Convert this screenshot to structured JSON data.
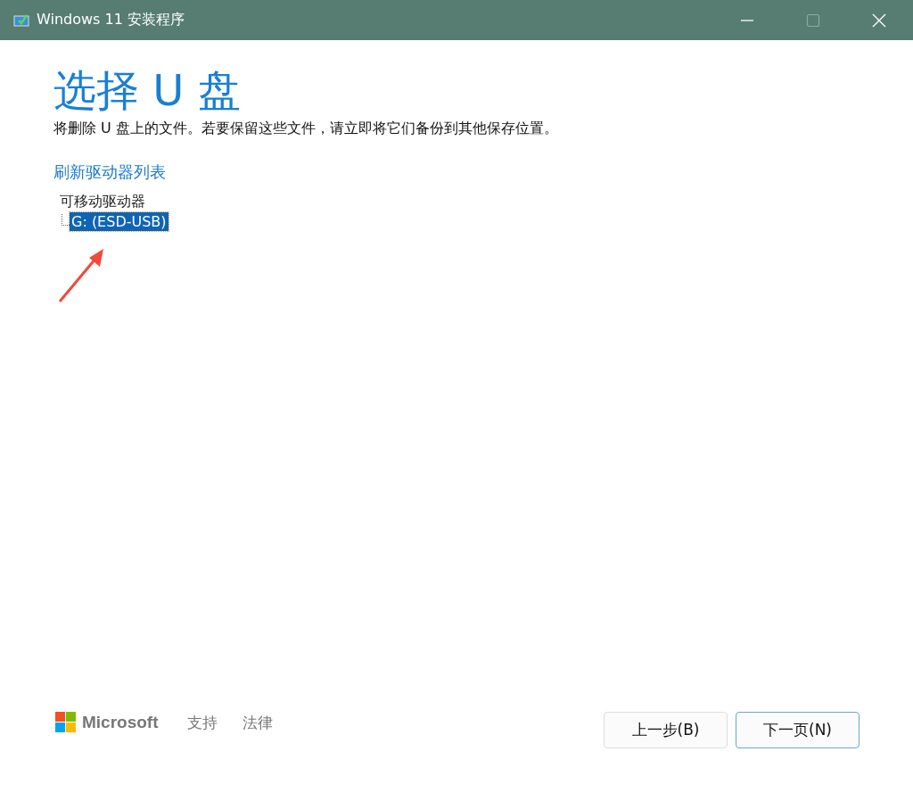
{
  "window": {
    "title": "Windows 11 安装程序"
  },
  "heading": "选择 U 盘",
  "description": "将删除 U 盘上的文件。若要保留这些文件，请立即将它们备份到其他保存位置。",
  "refresh_link": "刷新驱动器列表",
  "drive_tree": [
    {
      "label": "可移动驱动器",
      "selected": false,
      "children": [
        {
          "label": "G: (ESD-USB)",
          "selected": true
        }
      ]
    }
  ],
  "footer": {
    "brand": "Microsoft",
    "links": [
      "支持",
      "法律"
    ]
  },
  "buttons": [
    {
      "label": "上一步(B)",
      "focused": false
    },
    {
      "label": "下一页(N)",
      "focused": true
    }
  ]
}
